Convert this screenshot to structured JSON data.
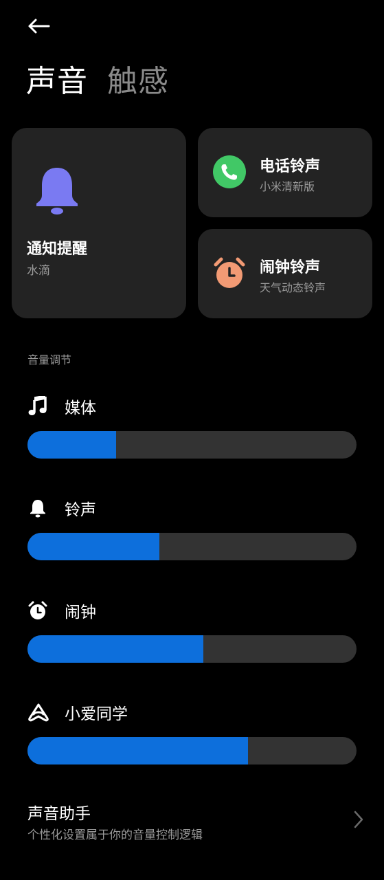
{
  "header": {
    "back_icon": "arrow-left-icon",
    "tabs": [
      {
        "label": "声音",
        "active": true
      },
      {
        "label": "触感",
        "active": false
      }
    ]
  },
  "cards": {
    "notification": {
      "title": "通知提醒",
      "subtitle": "水滴",
      "icon": "bell-icon",
      "color": "#7a7af2"
    },
    "phone": {
      "title": "电话铃声",
      "subtitle": "小米清新版",
      "icon": "phone-icon",
      "color": "#41c866"
    },
    "alarm": {
      "title": "闹钟铃声",
      "subtitle": "天气动态铃声",
      "icon": "alarm-clock-icon",
      "color": "#f29a74"
    }
  },
  "volume": {
    "section_label": "音量调节",
    "accent_color": "#0d6fdc",
    "items": [
      {
        "label": "媒体",
        "icon": "music-note-icon",
        "level": 0.27
      },
      {
        "label": "铃声",
        "icon": "bell-icon",
        "level": 0.4
      },
      {
        "label": "闹钟",
        "icon": "alarm-clock-icon",
        "level": 0.535
      },
      {
        "label": "小爱同学",
        "icon": "xiaoai-icon",
        "level": 0.67
      }
    ]
  },
  "assistant": {
    "title": "声音助手",
    "subtitle": "个性化设置属于你的音量控制逻辑",
    "icon": "chevron-right-icon"
  }
}
